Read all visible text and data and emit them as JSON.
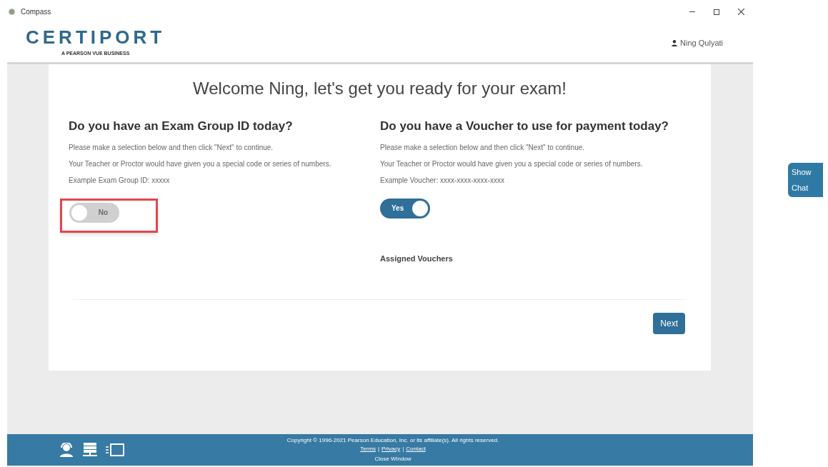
{
  "window": {
    "title": "Compass"
  },
  "header": {
    "logo": "CERTIPORT",
    "logo_tagline": "A PEARSON VUE BUSINESS",
    "user": "Ning Qulyati"
  },
  "welcome": "Welcome Ning, let's get you ready for your exam!",
  "sections": [
    {
      "heading": "Do you have an Exam Group ID today?",
      "lines": [
        "Please make a selection below and then click \"Next\" to continue.",
        "Your Teacher or Proctor would have given you a special code or series of numbers.",
        "Example Exam Group ID: xxxxx"
      ],
      "toggle": {
        "label": "No",
        "on": false,
        "highlighted": true
      }
    },
    {
      "heading": "Do you have a Voucher to use for payment today?",
      "lines": [
        "Please make a selection below and then click \"Next\" to continue.",
        "Your Teacher or Proctor would have given you a special code or series of numbers.",
        "Example Voucher: xxxx-xxxx-xxxx-xxxx"
      ],
      "toggle": {
        "label": "Yes",
        "on": true,
        "highlighted": false
      },
      "subheading": "Assigned Vouchers"
    }
  ],
  "next_button": "Next",
  "chat_button": [
    "Show",
    "Chat"
  ],
  "footer": {
    "copyright": "Copyright © 1996-2021 Pearson Education, Inc. or its affiliate(s). All rights reserved.",
    "links": [
      "Terms",
      "Privacy",
      "Contact"
    ],
    "separator": "|",
    "close": "Close Window"
  }
}
